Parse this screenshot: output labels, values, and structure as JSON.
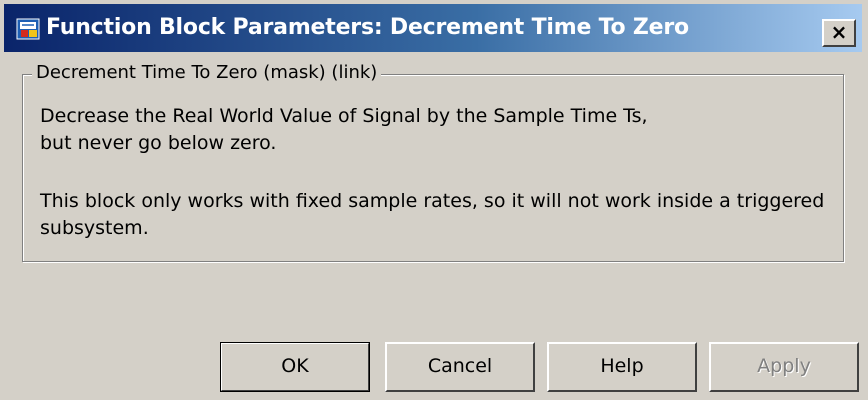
{
  "window": {
    "title": "Function Block Parameters: Decrement Time To Zero",
    "close_label": "×"
  },
  "group": {
    "legend": "Decrement Time To Zero (mask) (link)",
    "description_lines": [
      "Decrease the Real World Value of Signal by the Sample Time Ts,",
      "but never go below zero.",
      "This block only works with fixed sample rates, so it will not work inside a triggered",
      "subsystem."
    ]
  },
  "buttons": {
    "ok": "OK",
    "cancel": "Cancel",
    "help": "Help",
    "apply": "Apply",
    "apply_enabled": false
  },
  "icons": {
    "title_icon": "simulink-block-icon"
  },
  "colors": {
    "titlebar_start": "#0a246a",
    "titlebar_end": "#a6caf0",
    "dialog_face": "#d4d0c8"
  }
}
